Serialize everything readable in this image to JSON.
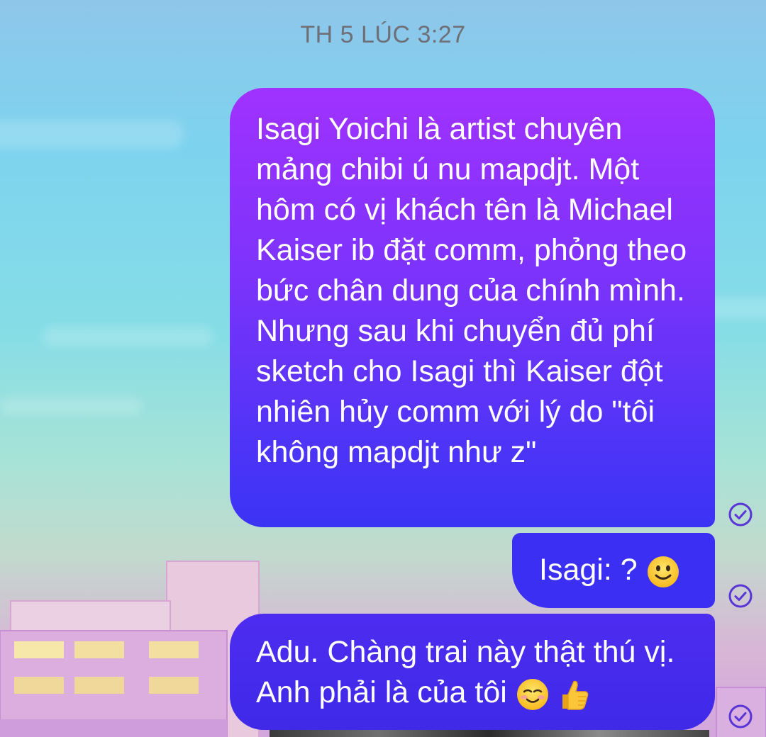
{
  "chat": {
    "timestamp": "TH 5 LÚC 3:27",
    "messages": [
      {
        "text": "Isagi Yoichi là artist chuyên mảng chibi ú nu mapdjt. Một hôm có vị khách tên là Michael Kaiser ib đặt comm, phỏng theo bức chân dung của chính mình. Nhưng sau khi chuyển đủ phí sketch cho Isagi thì Kaiser đột nhiên hủy comm với lý do \"tôi không mapdjt như z\"",
        "status": "read"
      },
      {
        "text": "Isagi: ? ",
        "emoji": "slightly-smiling-face",
        "status": "read"
      },
      {
        "text": "Adu. Chàng trai này thật thú vị. Anh phải là của tôi ",
        "emoji": "smiling-face-thumbs-up",
        "status": "read"
      }
    ]
  },
  "colors": {
    "bubble_top": "#a032ff",
    "bubble_bottom": "#3b34f5",
    "read_check": "#5a35d6",
    "timestamp": "#6f6f78"
  }
}
